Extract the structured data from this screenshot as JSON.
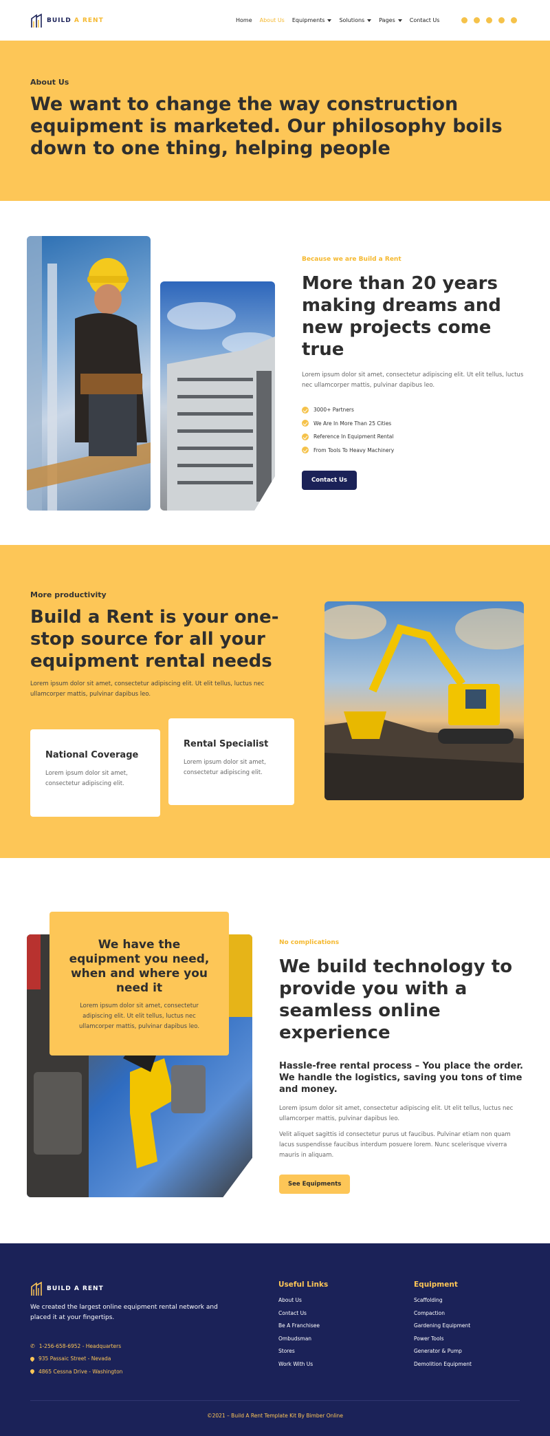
{
  "brand": {
    "word1": "BUILD",
    "word2": "A RENT"
  },
  "nav": [
    {
      "label": "Home",
      "active": false,
      "dropdown": false
    },
    {
      "label": "About Us",
      "active": true,
      "dropdown": false
    },
    {
      "label": "Equipments",
      "active": false,
      "dropdown": true
    },
    {
      "label": "Solutions",
      "active": false,
      "dropdown": true
    },
    {
      "label": "Pages",
      "active": false,
      "dropdown": true
    },
    {
      "label": "Contact Us",
      "active": false,
      "dropdown": false
    }
  ],
  "social": [
    "instagram-icon",
    "facebook-icon",
    "twitter-icon",
    "youtube-icon",
    "dribbble-icon"
  ],
  "hero": {
    "eyebrow": "About Us",
    "title": "We want to change the way construction equipment is marketed. Our philosophy boils down to one thing, helping people"
  },
  "about": {
    "kicker": "Because we are Build a Rent",
    "title": "More than 20 years making dreams and new projects come true",
    "body": "Lorem ipsum dolor sit amet, consectetur adipiscing elit. Ut elit tellus, luctus nec ullamcorper mattis, pulvinar dapibus leo.",
    "checks": [
      "3000+ Partners",
      "We Are In More Than 25 Cities",
      "Reference In Equipment Rental",
      "From Tools To Heavy Machinery"
    ],
    "button": "Contact Us"
  },
  "productivity": {
    "eyebrow": "More productivity",
    "title": "Build a Rent is your one-stop source for all your equipment rental needs",
    "body": "Lorem ipsum dolor sit amet, consectetur adipiscing elit. Ut elit tellus, luctus nec ullamcorper mattis, pulvinar dapibus leo.",
    "cards": [
      {
        "title": "National Coverage",
        "body": "Lorem ipsum dolor sit amet, consectetur adipiscing elit."
      },
      {
        "title": "Rental Specialist",
        "body": "Lorem ipsum dolor sit amet, consectetur adipiscing elit."
      }
    ]
  },
  "tech": {
    "box_title": "We have the equipment you need, when and where you need it",
    "box_body": "Lorem ipsum dolor sit amet, consectetur adipiscing elit. Ut elit tellus, luctus nec ullamcorper mattis, pulvinar dapibus leo.",
    "kicker": "No complications",
    "title": "We build technology to provide you with a seamless online experience",
    "subtitle": "Hassle-free rental process – You place the order. We handle the logistics, saving you tons of time and money.",
    "body1": "Lorem ipsum dolor sit amet, consectetur adipiscing elit. Ut elit tellus, luctus nec ullamcorper mattis, pulvinar dapibus leo.",
    "body2": "Velit aliquet sagittis id consectetur purus ut faucibus. Pulvinar etiam non quam lacus suspendisse faucibus interdum posuere lorem. Nunc scelerisque viverra mauris in aliquam.",
    "button": "See Equipments"
  },
  "footer": {
    "description": "We created the largest online equipment rental network and placed it at your fingertips.",
    "contacts": [
      "1-256-658-6952 - Headquarters",
      "935 Passaic Street - Nevada",
      "4865 Cessna Drive - Washington"
    ],
    "useful_title": "Useful Links",
    "useful_links": [
      "About Us",
      "Contact Us",
      "Be A Franchisee",
      "Ombudsman",
      "Stores",
      "Work With Us"
    ],
    "equipment_title": "Equipment",
    "equipment_links": [
      "Scaffolding",
      "Compaction",
      "Gardening Equipment",
      "Power Tools",
      "Generator & Pump",
      "Demolition Equipment"
    ],
    "copyright": "©2021 – Build A Rent Template Kit By Bimber Online"
  },
  "colors": {
    "accent": "#fdc657",
    "navy": "#1b2258"
  }
}
